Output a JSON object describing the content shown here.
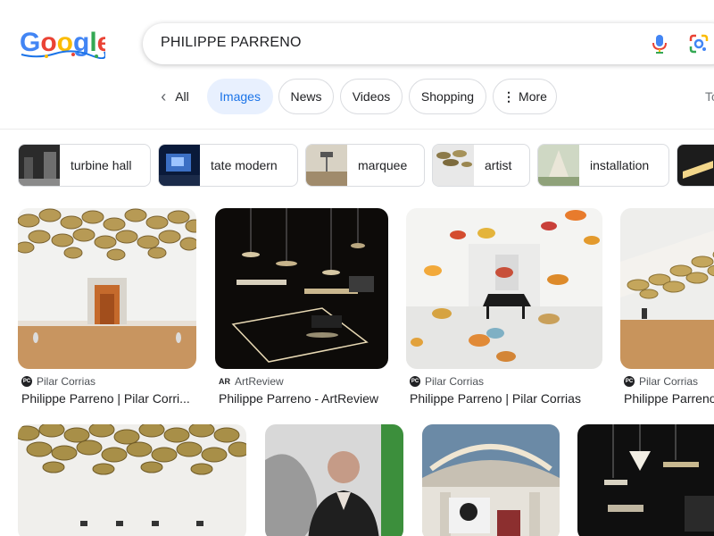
{
  "search": {
    "query": "PHILIPPE PARRENO"
  },
  "tabs": [
    {
      "label": "All"
    },
    {
      "label": "Images"
    },
    {
      "label": "News"
    },
    {
      "label": "Videos"
    },
    {
      "label": "Shopping"
    },
    {
      "label": "More"
    }
  ],
  "tools_label": "To",
  "chips": [
    {
      "label": "turbine hall"
    },
    {
      "label": "tate modern"
    },
    {
      "label": "marquee"
    },
    {
      "label": "artist"
    },
    {
      "label": "installation"
    }
  ],
  "results": [
    {
      "source": "Pilar Corrias",
      "favicon": "PC",
      "title": "Philippe Parreno | Pilar Corri..."
    },
    {
      "source": "ArtReview",
      "favicon": "AR",
      "title": "Philippe Parreno - ArtReview"
    },
    {
      "source": "Pilar Corrias",
      "favicon": "PC",
      "title": "Philippe Parreno | Pilar Corrias"
    },
    {
      "source": "Pilar Corrias",
      "favicon": "PC",
      "title": "Philippe Parreno"
    }
  ],
  "colors": {
    "accent": "#1a73e8",
    "active_tab_bg": "#e8f0fe"
  }
}
